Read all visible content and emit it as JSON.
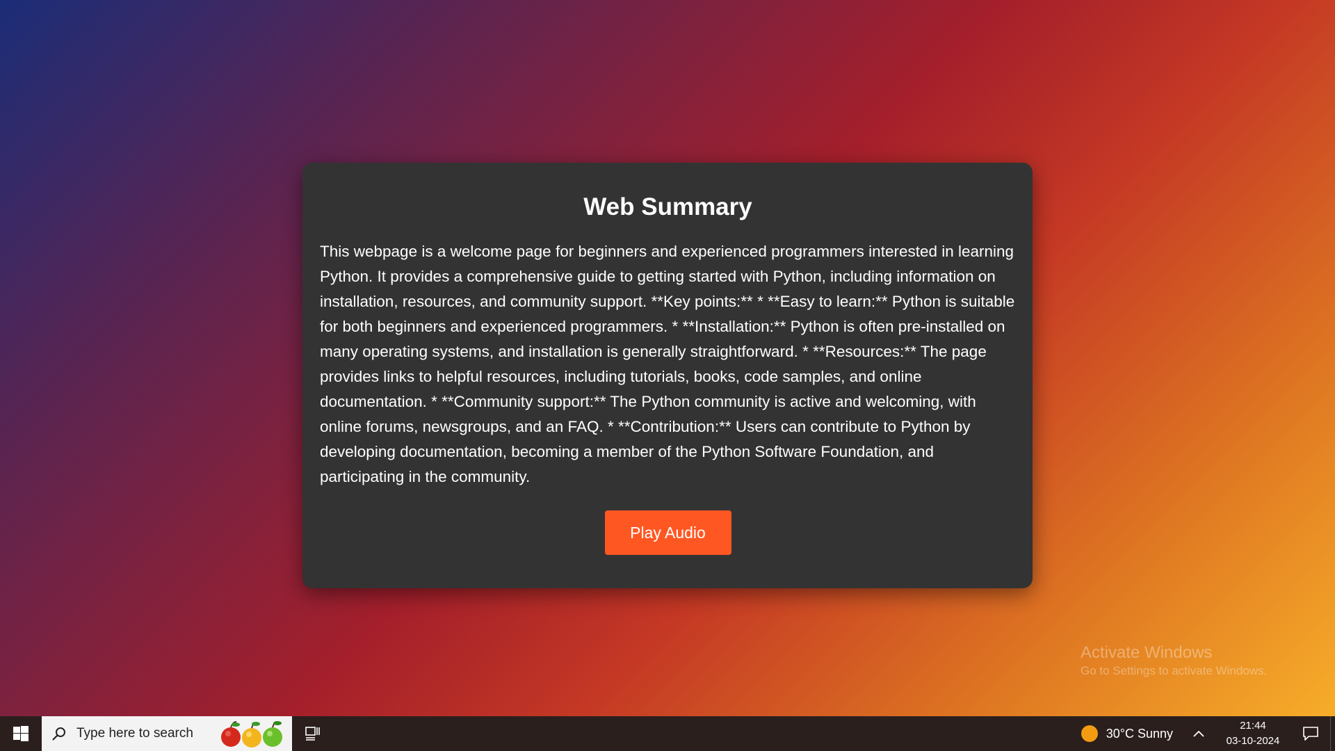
{
  "card": {
    "title": "Web Summary",
    "body": "This webpage is a welcome page for beginners and experienced programmers interested in learning Python. It provides a comprehensive guide to getting started with Python, including information on installation, resources, and community support. **Key points:** * **Easy to learn:** Python is suitable for both beginners and experienced programmers. * **Installation:** Python is often pre-installed on many operating systems, and installation is generally straightforward. * **Resources:** The page provides links to helpful resources, including tutorials, books, code samples, and online documentation. * **Community support:** The Python community is active and welcoming, with online forums, newsgroups, and an FAQ. * **Contribution:** Users can contribute to Python by developing documentation, becoming a member of the Python Software Foundation, and participating in the community.",
    "button_label": "Play Audio"
  },
  "watermark": {
    "title": "Activate Windows",
    "subtitle": "Go to Settings to activate Windows."
  },
  "taskbar": {
    "search_placeholder": "Type here to search",
    "weather": "30°C  Sunny",
    "time": "21:44",
    "date": "03-10-2024"
  },
  "colors": {
    "card_bg": "#333333",
    "button_bg": "#ff5722",
    "taskbar_bg": "#2b1f1e"
  },
  "icons": [
    "windows-start-icon",
    "search-icon",
    "fruits-icon",
    "task-view-icon",
    "sun-icon",
    "chevron-up-icon",
    "notification-icon"
  ]
}
